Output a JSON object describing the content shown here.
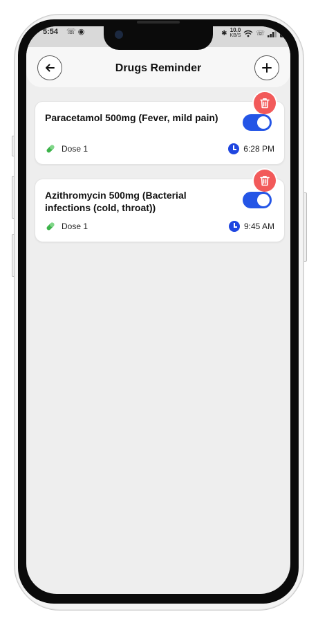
{
  "status": {
    "time": "5:54",
    "left_icons": "☏ ◉",
    "speed_value": "10.0",
    "speed_unit": "KB/S"
  },
  "header": {
    "title": "Drugs Reminder",
    "back_icon": "arrow-left-icon",
    "add_icon": "plus-icon"
  },
  "reminders": [
    {
      "name": "Paracetamol 500mg (Fever, mild pain)",
      "dose": "Dose 1",
      "time": "6:28 PM",
      "enabled": true
    },
    {
      "name": "Azithromycin 500mg (Bacterial infections (cold, throat))",
      "dose": "Dose 1",
      "time": "9:45 AM",
      "enabled": true
    }
  ],
  "colors": {
    "accent": "#2455e6",
    "danger": "#f25a5a",
    "pill": "#3cb34a",
    "background": "#eeeeee"
  }
}
